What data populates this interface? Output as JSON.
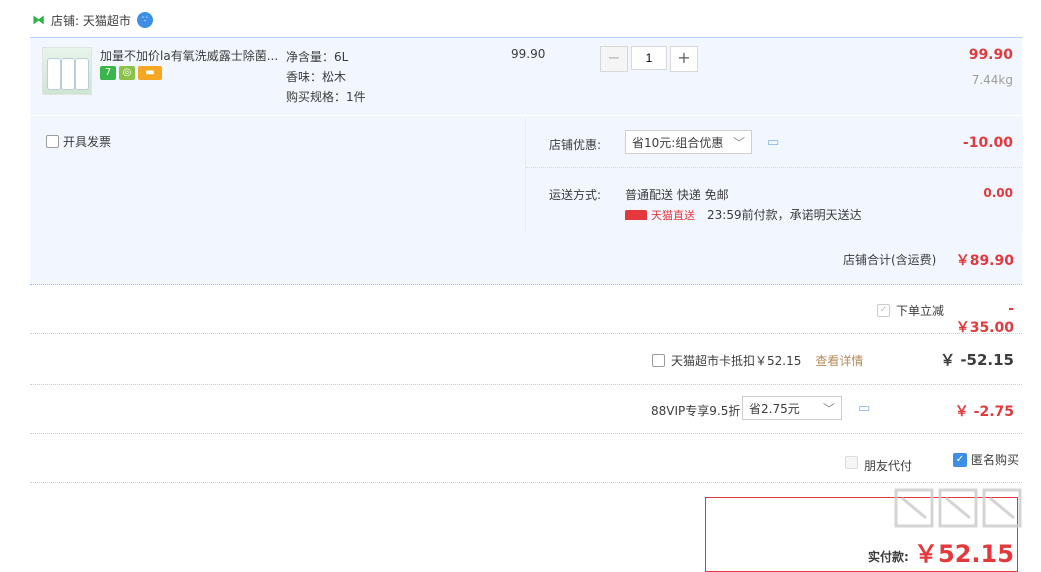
{
  "shop": {
    "label": "店铺: 天猫超市"
  },
  "item": {
    "title": "加量不加价la有氧洗威露士除菌...",
    "spec_volume": "净含量：6L",
    "spec_scent": "香味：松木",
    "spec_pack": "购买规格：1件",
    "unit_price": "99.90",
    "quantity": "1",
    "minus": "−",
    "plus": "+",
    "subtotal": "99.90",
    "weight": "7.44kg",
    "badge_7": "7"
  },
  "invoice": {
    "label": "开具发票"
  },
  "shop_discount": {
    "label": "店铺优惠:",
    "selected": "省10元:组合优惠",
    "amount": "-10.00"
  },
  "shipping": {
    "label": "运送方式:",
    "method": "普通配送 快递 免邮",
    "tmall_direct": "天猫直送",
    "promise": "23:59前付款，承诺明天送达",
    "amount": "0.00"
  },
  "shop_total": {
    "label": "店铺合计(含运费)",
    "amount": "￥89.90"
  },
  "order_discount": {
    "label": "下单立减",
    "amount": "-￥35.00"
  },
  "card": {
    "label": "天猫超市卡抵扣￥52.15",
    "link": "查看详情",
    "amount": "￥ -52.15"
  },
  "vip": {
    "label": "88VIP专享9.5折",
    "selected": "省2.75元",
    "amount": "￥ -2.75"
  },
  "options": {
    "friend_pay": "朋友代付",
    "anonymous": "匿名购买"
  },
  "payment": {
    "label": "实付款:",
    "amount": "￥52.15"
  },
  "colors": {
    "accent": "#e4393c",
    "blue_bg": "#f2f7ff",
    "check_blue": "#3c8ee6"
  }
}
